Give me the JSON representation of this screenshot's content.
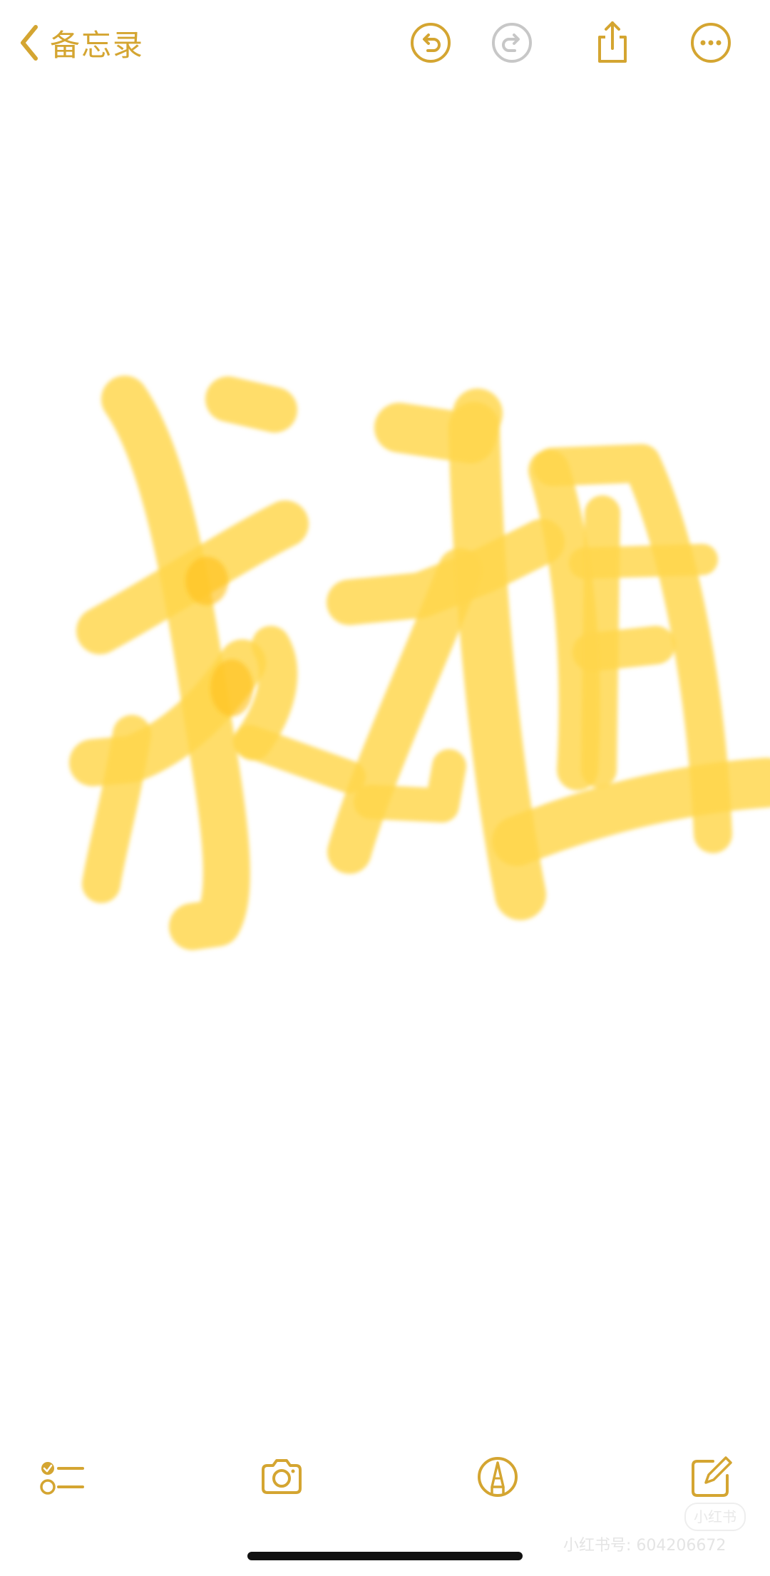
{
  "nav": {
    "back_label": "备忘录"
  },
  "toolbar_top": {
    "icons": [
      "undo-icon",
      "redo-icon",
      "share-icon",
      "more-icon"
    ],
    "redo_enabled": false
  },
  "toolbar_bottom": {
    "icons": [
      "checklist-icon",
      "camera-icon",
      "markup-pen-icon",
      "compose-icon"
    ]
  },
  "watermark": {
    "logo_text": "小红书",
    "text": "小红书号: 604206672"
  },
  "colors": {
    "accent": "#D4A531",
    "ink": "#FFD54A",
    "disabled": "#C7C7C7",
    "background": "#FFFFFF"
  }
}
